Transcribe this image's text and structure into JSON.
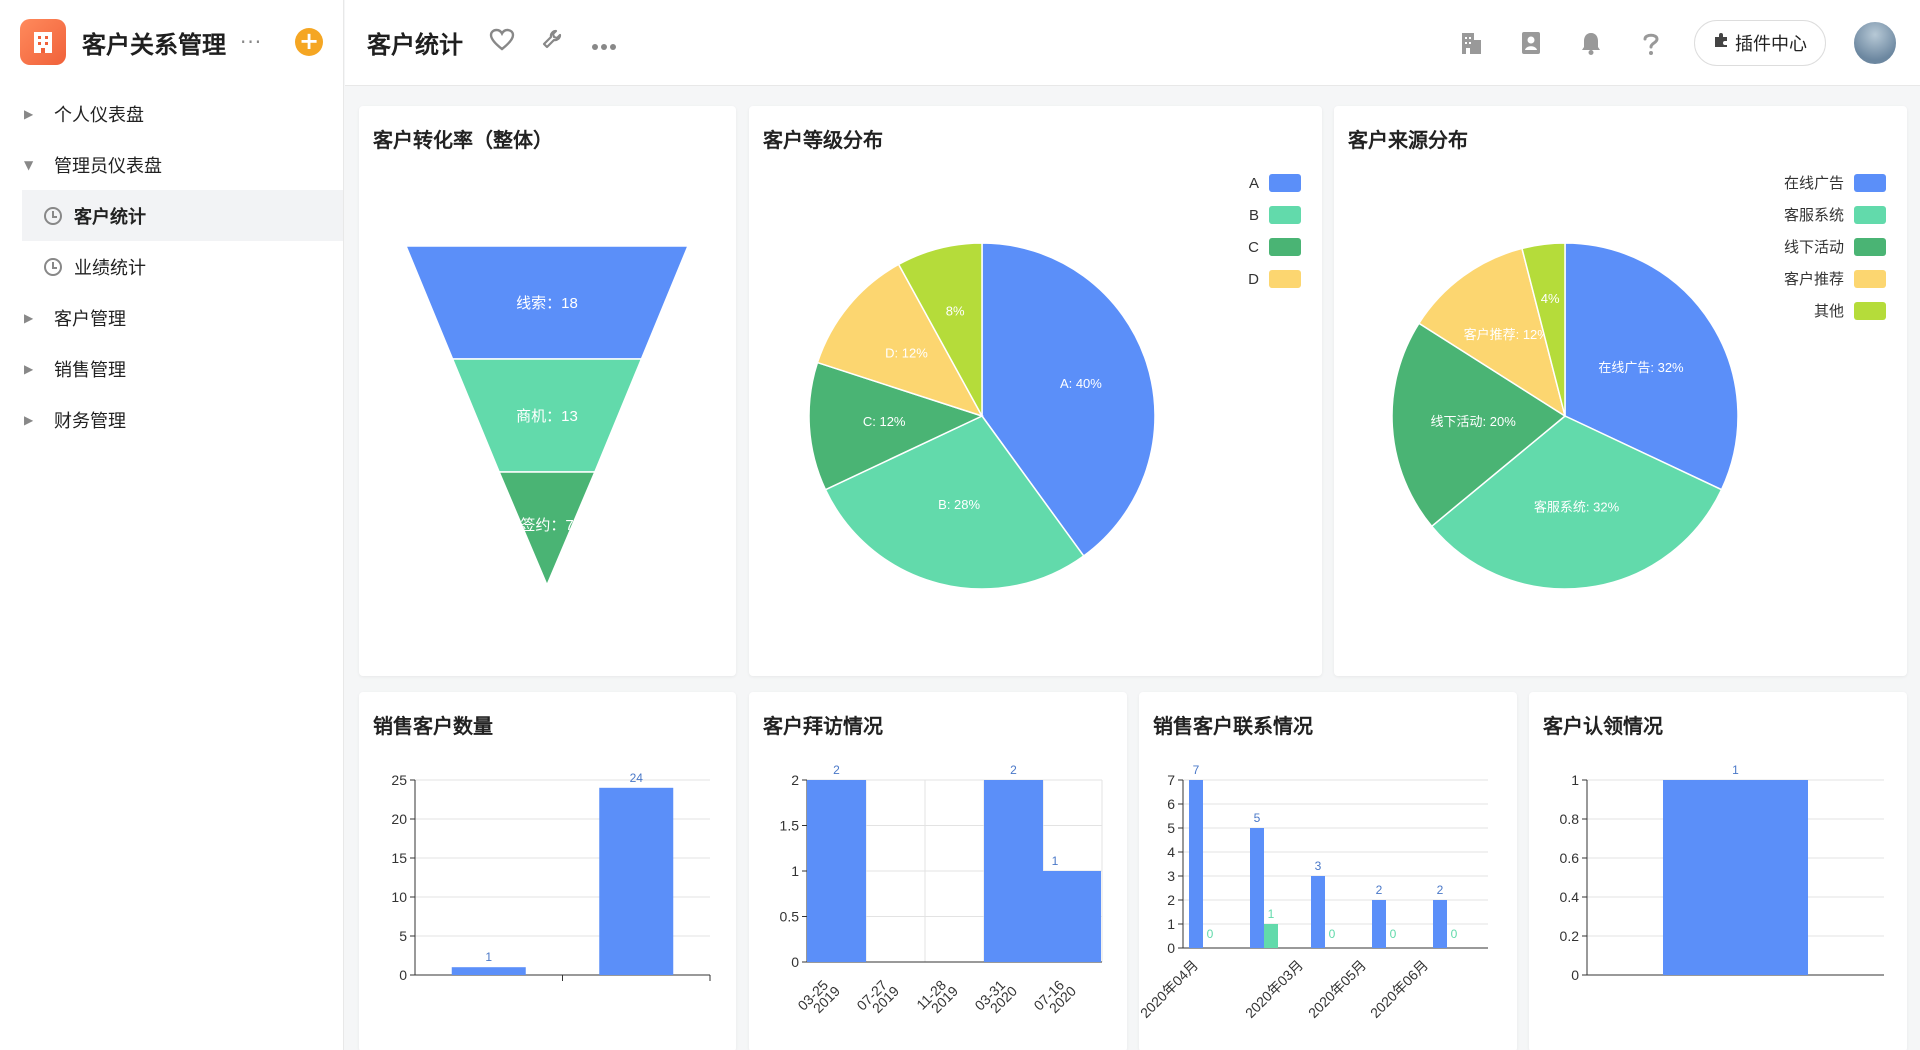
{
  "app": {
    "title": "客户关系管理",
    "more": "···",
    "add": "+"
  },
  "sidebar": {
    "items": [
      {
        "label": "个人仪表盘",
        "type": "group",
        "expanded": false
      },
      {
        "label": "管理员仪表盘",
        "type": "group",
        "expanded": true
      },
      {
        "label": "客户统计",
        "type": "page",
        "active": true
      },
      {
        "label": "业绩统计",
        "type": "page",
        "active": false
      },
      {
        "label": "客户管理",
        "type": "group",
        "expanded": false
      },
      {
        "label": "销售管理",
        "type": "group",
        "expanded": false
      },
      {
        "label": "财务管理",
        "type": "group",
        "expanded": false
      }
    ]
  },
  "topbar": {
    "title": "客户统计",
    "plugin_label": "插件中心",
    "icons": [
      "heart-icon",
      "wrench-icon",
      "more-icon",
      "building-icon",
      "contacts-icon",
      "bell-icon",
      "help-icon"
    ]
  },
  "cards": {
    "funnel": {
      "title": "客户转化率（整体）"
    },
    "grade": {
      "title": "客户等级分布"
    },
    "source": {
      "title": "客户来源分布"
    },
    "sales_count": {
      "title": "销售客户数量"
    },
    "visits": {
      "title": "客户拜访情况"
    },
    "contacts": {
      "title": "销售客户联系情况"
    },
    "claims": {
      "title": "客户认领情况"
    }
  },
  "colors": {
    "blue": "#5b8ff9",
    "green": "#62daab",
    "darkgreen": "#4ab474",
    "yellow": "#fcd670",
    "lime": "#b5dc3a",
    "brand": "#f0613a",
    "orange": "#f5a623"
  },
  "chart_data": [
    {
      "type": "funnel",
      "stages": [
        {
          "label": "线索",
          "value": 18
        },
        {
          "label": "商机",
          "value": 13
        },
        {
          "label": "签约",
          "value": 7
        }
      ],
      "labels": [
        "线索：18",
        "商机：13",
        "签约：7"
      ]
    },
    {
      "type": "pie",
      "legend": [
        "A",
        "B",
        "C",
        "D"
      ],
      "slices": [
        {
          "name": "A",
          "value": 40,
          "label": "A: 40%"
        },
        {
          "name": "B",
          "value": 28,
          "label": "B: 28%"
        },
        {
          "name": "C",
          "value": 12,
          "label": "C: 12%"
        },
        {
          "name": "D",
          "value": 12,
          "label": "D: 12%"
        },
        {
          "name": "",
          "value": 8,
          "label": "8%"
        }
      ],
      "legend_position": "top-right"
    },
    {
      "type": "pie",
      "legend": [
        "在线广告",
        "客服系统",
        "线下活动",
        "客户推荐",
        "其他"
      ],
      "slices": [
        {
          "name": "在线广告",
          "value": 32,
          "label": "在线广告: 32%"
        },
        {
          "name": "客服系统",
          "value": 32,
          "label": "客服系统: 32%"
        },
        {
          "name": "线下活动",
          "value": 20,
          "label": "线下活动: 20%"
        },
        {
          "name": "客户推荐",
          "value": 12,
          "label": "客户推荐: 12%"
        },
        {
          "name": "其他",
          "value": 4,
          "label": "4%"
        }
      ],
      "legend_position": "top-right"
    },
    {
      "type": "bar",
      "values": [
        1,
        24
      ],
      "labels": [
        "1",
        "24"
      ],
      "ylim": [
        0,
        25
      ],
      "yticks": [
        "0",
        "5",
        "10",
        "15",
        "20",
        "25"
      ],
      "grid": true
    },
    {
      "type": "bar",
      "categories": [
        "03-25\n2019",
        "07-27\n2019",
        "11-28\n2019",
        "03-31\n2020",
        "07-16\n2020"
      ],
      "values": [
        2,
        2,
        1
      ],
      "ylim": [
        0,
        2
      ],
      "yticks": [
        "0",
        "0.5",
        "1",
        "1.5",
        "2"
      ],
      "grid": true
    },
    {
      "type": "bar",
      "categories": [
        "2020年04月",
        "2020年03月",
        "2020年05月",
        "2020年06月"
      ],
      "series": [
        {
          "values": [
            7,
            5,
            3,
            2,
            2
          ]
        },
        {
          "values": [
            0,
            1,
            0,
            0,
            0
          ]
        }
      ],
      "ylim": [
        0,
        7
      ],
      "yticks": [
        "0",
        "1",
        "2",
        "3",
        "4",
        "5",
        "6",
        "7"
      ],
      "grid": true
    },
    {
      "type": "bar",
      "values": [
        1
      ],
      "labels": [
        "1"
      ],
      "ylim": [
        0,
        1
      ],
      "yticks": [
        "0",
        "0.2",
        "0.4",
        "0.6",
        "0.8",
        "1"
      ],
      "grid": true
    }
  ]
}
